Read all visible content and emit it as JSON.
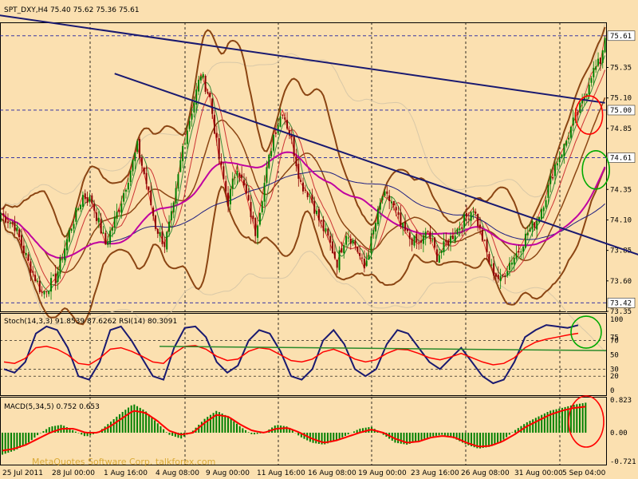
{
  "chart_data": [
    {
      "type": "candlestick",
      "title": "SPT_DXY,H4  75.40 75.62 75.36 75.61",
      "symbol": "SPT_DXY",
      "timeframe": "H4",
      "ohlc_label": "75.40 75.62 75.36 75.61",
      "ylim": [
        73.35,
        75.72
      ],
      "y_ticks": [
        "75.35",
        "75.10",
        "74.85",
        "74.35",
        "74.10",
        "73.85",
        "73.60",
        "73.35"
      ],
      "price_tags": [
        {
          "value": 75.61,
          "label": "75.61",
          "fill": "#ffffff"
        },
        {
          "value": 75.0,
          "label": "75.00",
          "fill": "#ffffff"
        },
        {
          "value": 74.61,
          "label": "74.61",
          "fill": "#ffffff"
        },
        {
          "value": 73.42,
          "label": "73.42",
          "fill": "#ffffff"
        }
      ],
      "x_labels": [
        "25 Jul 2011",
        "28 Jul 00:00",
        "1 Aug 16:00",
        "4 Aug 08:00",
        "9 Aug 00:00",
        "11 Aug 16:00",
        "16 Aug 08:00",
        "19 Aug 00:00",
        "23 Aug 16:00",
        "26 Aug 08:00",
        "31 Aug 00:00",
        "5 Sep 04:00"
      ],
      "close_path": [
        [
          0,
          74.15
        ],
        [
          6,
          74.05
        ],
        [
          12,
          73.75
        ],
        [
          18,
          73.5
        ],
        [
          24,
          73.62
        ],
        [
          30,
          74.0
        ],
        [
          36,
          74.3
        ],
        [
          40,
          74.25
        ],
        [
          46,
          73.9
        ],
        [
          52,
          74.2
        ],
        [
          56,
          74.45
        ],
        [
          60,
          74.7
        ],
        [
          64,
          74.4
        ],
        [
          68,
          74.05
        ],
        [
          72,
          73.9
        ],
        [
          76,
          74.2
        ],
        [
          80,
          74.7
        ],
        [
          84,
          75.0
        ],
        [
          88,
          75.3
        ],
        [
          92,
          75.1
        ],
        [
          96,
          74.6
        ],
        [
          100,
          74.25
        ],
        [
          104,
          74.55
        ],
        [
          108,
          74.3
        ],
        [
          112,
          74.0
        ],
        [
          116,
          74.4
        ],
        [
          120,
          74.8
        ],
        [
          124,
          75.0
        ],
        [
          128,
          74.75
        ],
        [
          132,
          74.4
        ],
        [
          136,
          74.3
        ],
        [
          140,
          74.1
        ],
        [
          144,
          73.95
        ],
        [
          148,
          73.75
        ],
        [
          152,
          74.0
        ],
        [
          156,
          73.9
        ],
        [
          160,
          73.7
        ],
        [
          164,
          74.0
        ],
        [
          168,
          74.3
        ],
        [
          172,
          74.25
        ],
        [
          176,
          74.05
        ],
        [
          180,
          73.95
        ],
        [
          184,
          73.9
        ],
        [
          188,
          74.0
        ],
        [
          192,
          73.8
        ],
        [
          196,
          73.9
        ],
        [
          200,
          74.0
        ],
        [
          204,
          74.1
        ],
        [
          208,
          74.2
        ],
        [
          212,
          73.95
        ],
        [
          216,
          73.7
        ],
        [
          220,
          73.6
        ],
        [
          224,
          73.75
        ],
        [
          228,
          73.85
        ],
        [
          232,
          74.0
        ],
        [
          236,
          74.1
        ],
        [
          240,
          74.3
        ],
        [
          244,
          74.55
        ],
        [
          248,
          74.7
        ],
        [
          252,
          74.9
        ],
        [
          256,
          75.05
        ],
        [
          260,
          75.3
        ],
        [
          264,
          75.4
        ],
        [
          266,
          75.61
        ]
      ],
      "drawn_trendlines": [
        {
          "name": "blue-trendline-upper",
          "from": [
            -20,
            75.83
          ],
          "to": [
            266,
            75.06
          ],
          "color": "#191970"
        },
        {
          "name": "blue-trendline-lower",
          "from": [
            50,
            75.3
          ],
          "to": [
            283,
            73.8
          ],
          "color": "#191970"
        }
      ],
      "annotation_circles": [
        {
          "name": "red-circle-price",
          "at": [
            259,
            74.96
          ],
          "color": "#ff0000"
        },
        {
          "name": "green-circle-price",
          "at": [
            262,
            74.51
          ],
          "color": "#00aa00"
        }
      ]
    },
    {
      "type": "line",
      "title": "Stoch(14,3,3) 91.8539 87.6262  RSI(14) 80.3091",
      "ylim": [
        0,
        100
      ],
      "y_ticks": [
        "100",
        "75",
        "70",
        "50",
        "30",
        "20",
        "0"
      ],
      "series": [
        {
          "name": "Stoch(14,3,3)",
          "color": "#191970",
          "values": [
            30,
            25,
            40,
            80,
            90,
            85,
            60,
            20,
            15,
            40,
            85,
            90,
            70,
            45,
            20,
            15,
            60,
            88,
            90,
            75,
            40,
            25,
            35,
            70,
            85,
            80,
            55,
            20,
            15,
            30,
            70,
            85,
            65,
            30,
            20,
            30,
            65,
            85,
            80,
            60,
            40,
            30,
            45,
            60,
            40,
            20,
            10,
            15,
            40,
            75,
            85,
            92,
            90,
            88,
            91.85
          ]
        },
        {
          "name": "RSI(14)",
          "color": "#ff0000",
          "values": [
            40,
            38,
            45,
            60,
            62,
            58,
            50,
            38,
            36,
            45,
            58,
            60,
            55,
            48,
            40,
            38,
            52,
            62,
            63,
            58,
            48,
            42,
            44,
            55,
            60,
            58,
            50,
            42,
            40,
            44,
            54,
            58,
            52,
            44,
            40,
            43,
            52,
            58,
            57,
            52,
            46,
            43,
            47,
            52,
            46,
            40,
            36,
            38,
            46,
            60,
            68,
            72,
            75,
            78,
            80.31
          ]
        }
      ]
    },
    {
      "type": "bar",
      "title": "MACD(5,34,5) 0.752 0.653",
      "ylim": [
        -0.8,
        0.9
      ],
      "y_ticks": [
        "0.823",
        "0.00",
        "-0.721"
      ],
      "series": [
        {
          "name": "MACD(5,34,5)",
          "color": "#008000",
          "values": [
            -0.55,
            -0.45,
            -0.3,
            -0.05,
            0.15,
            0.2,
            0.05,
            -0.1,
            0.0,
            0.25,
            0.5,
            0.72,
            0.55,
            0.25,
            -0.05,
            -0.15,
            0.05,
            0.35,
            0.55,
            0.4,
            0.15,
            -0.05,
            0.0,
            0.2,
            0.15,
            -0.1,
            -0.25,
            -0.3,
            -0.2,
            -0.05,
            0.1,
            0.15,
            -0.05,
            -0.25,
            -0.3,
            -0.2,
            -0.1,
            -0.05,
            -0.15,
            -0.3,
            -0.4,
            -0.35,
            -0.2,
            0.05,
            0.25,
            0.4,
            0.55,
            0.62,
            0.7,
            0.752
          ]
        },
        {
          "name": "Signal",
          "color": "#ff0000",
          "values": [
            -0.45,
            -0.4,
            -0.3,
            -0.15,
            0.0,
            0.1,
            0.1,
            0.0,
            0.0,
            0.15,
            0.35,
            0.55,
            0.5,
            0.3,
            0.05,
            -0.05,
            0.0,
            0.25,
            0.45,
            0.4,
            0.2,
            0.05,
            0.0,
            0.1,
            0.12,
            0.0,
            -0.15,
            -0.25,
            -0.2,
            -0.1,
            0.0,
            0.08,
            0.0,
            -0.15,
            -0.25,
            -0.22,
            -0.12,
            -0.08,
            -0.12,
            -0.25,
            -0.35,
            -0.33,
            -0.22,
            -0.05,
            0.15,
            0.3,
            0.45,
            0.55,
            0.62,
            0.653
          ]
        }
      ]
    }
  ],
  "watermark": "MetaQuotes Software Corp.  talkforex.com",
  "colors": {
    "background": "#fbe0b0",
    "bull_candle": "#008000",
    "bear_candle": "#8b0000",
    "bollinger": "#8b4513",
    "ma_magenta": "#c000a0",
    "ma_navy": "#1e1e80",
    "grid": "#000000"
  }
}
